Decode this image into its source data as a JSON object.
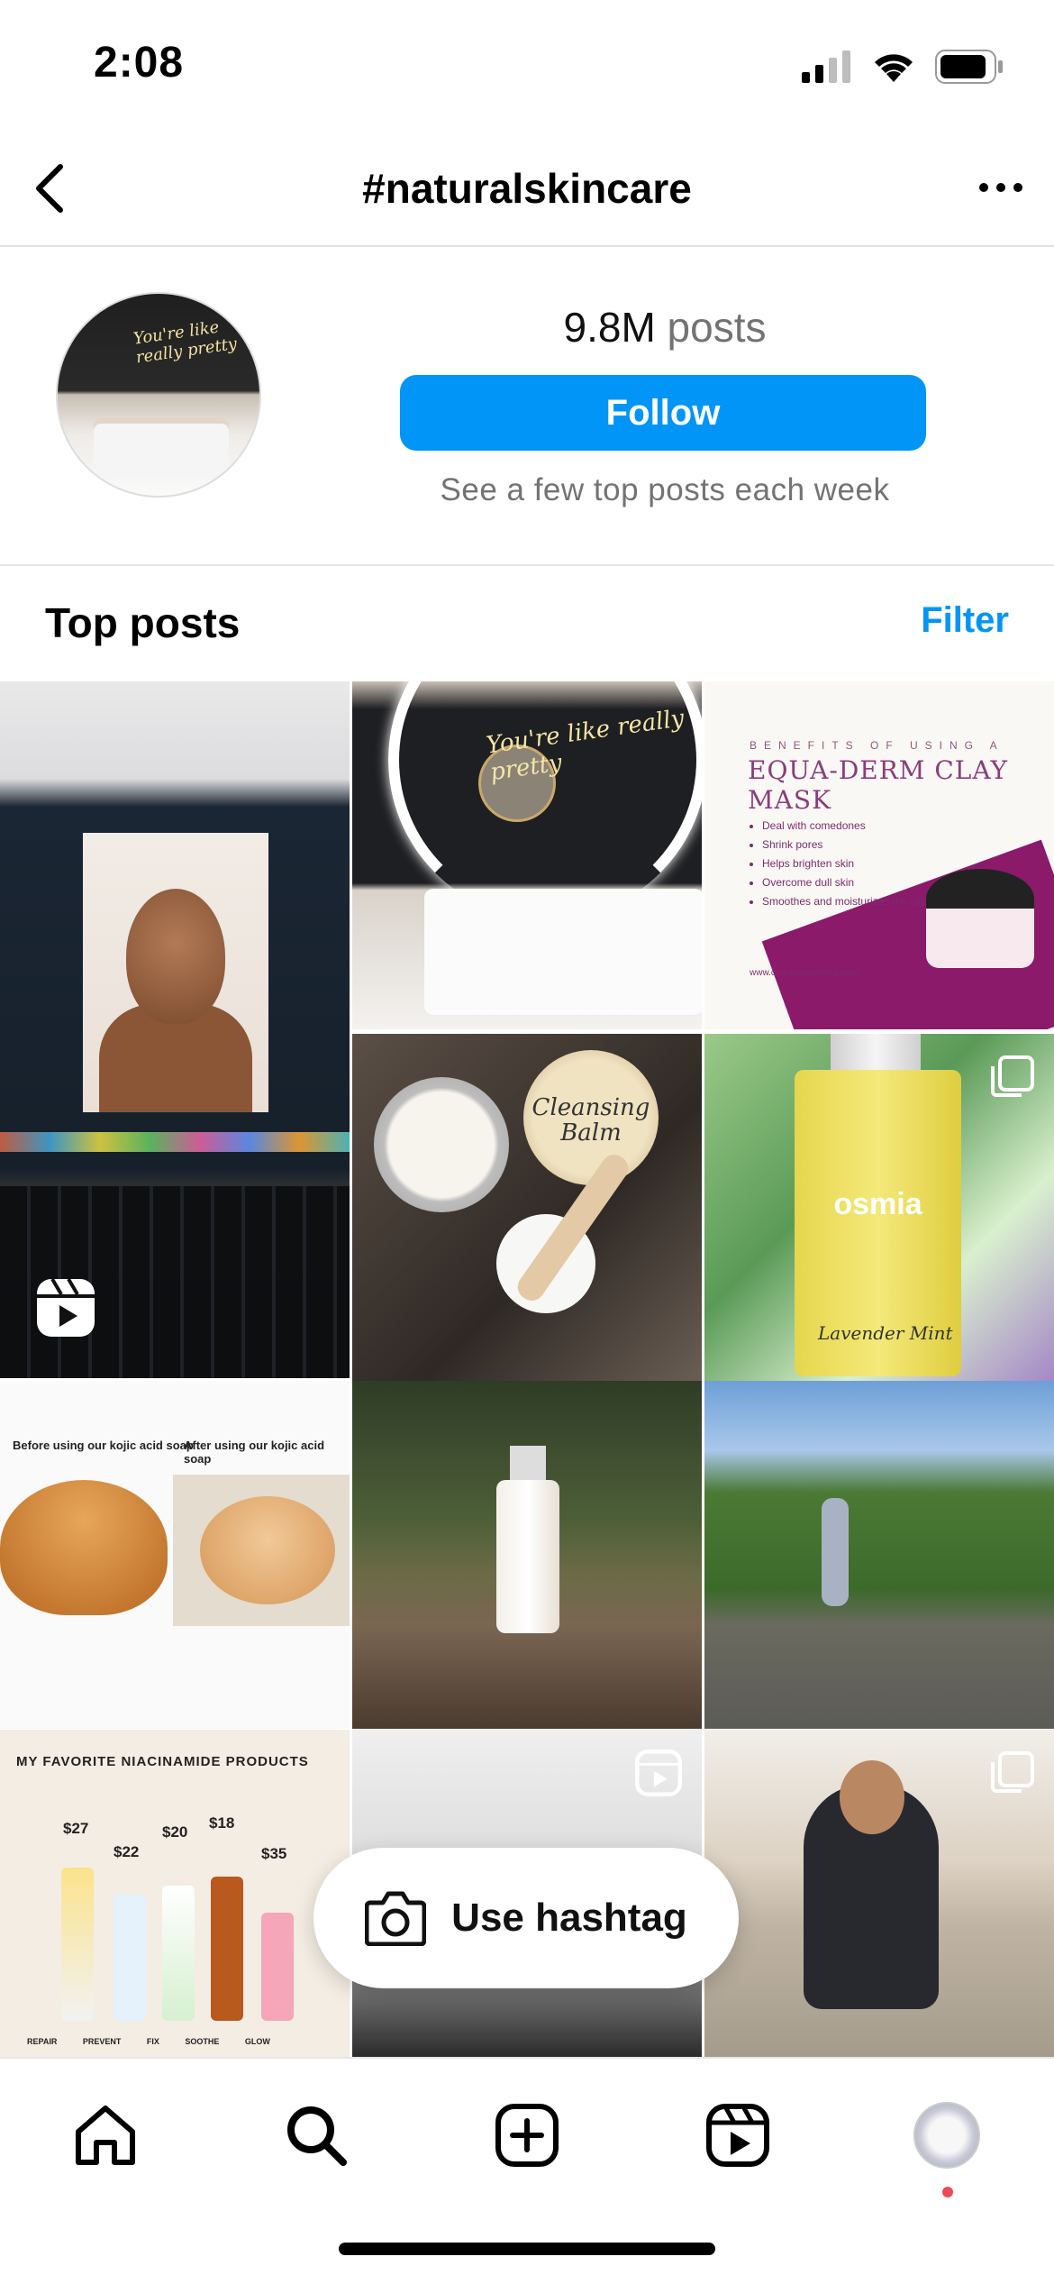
{
  "status_bar": {
    "time": "2:08"
  },
  "header": {
    "title": "#naturalskincare"
  },
  "hashtag_info": {
    "posts_number": "9.8M",
    "posts_label": "posts",
    "follow_label": "Follow",
    "subtext": "See a few top posts each week"
  },
  "section": {
    "title": "Top posts",
    "filter_label": "Filter"
  },
  "posts": {
    "p2_neon": "You're like really pretty",
    "p3": {
      "kicker": "BENEFITS OF USING A",
      "title": "EQUA-DERM CLAY MASK",
      "bullets": [
        "Deal with comedones",
        "Shrink pores",
        "Helps brighten skin",
        "Overcome dull skin",
        "Smoothes and moisturizes the skin"
      ],
      "url": "www.cruzancosmetics.com"
    },
    "p4": {
      "lid_text": "Cleansing Balm"
    },
    "p5": {
      "brand": "osmia",
      "label": "Lavender Mint"
    },
    "p6": {
      "before": "Before using our kojic acid soap",
      "after": "After using our kojic acid soap"
    },
    "p9": {
      "heading": "MY FAVORITE NIACINAMIDE PRODUCTS",
      "prices": [
        "$27",
        "$22",
        "$20",
        "$18",
        "$35"
      ],
      "labels": "REPAIR PREVENT FIX SOOTHE GLOW"
    }
  },
  "use_hashtag": {
    "label": "Use hashtag"
  },
  "tabs": [
    "home",
    "search",
    "create",
    "reels",
    "profile"
  ],
  "colors": {
    "accent": "#0095f6",
    "notification_dot": "#ed4956"
  }
}
